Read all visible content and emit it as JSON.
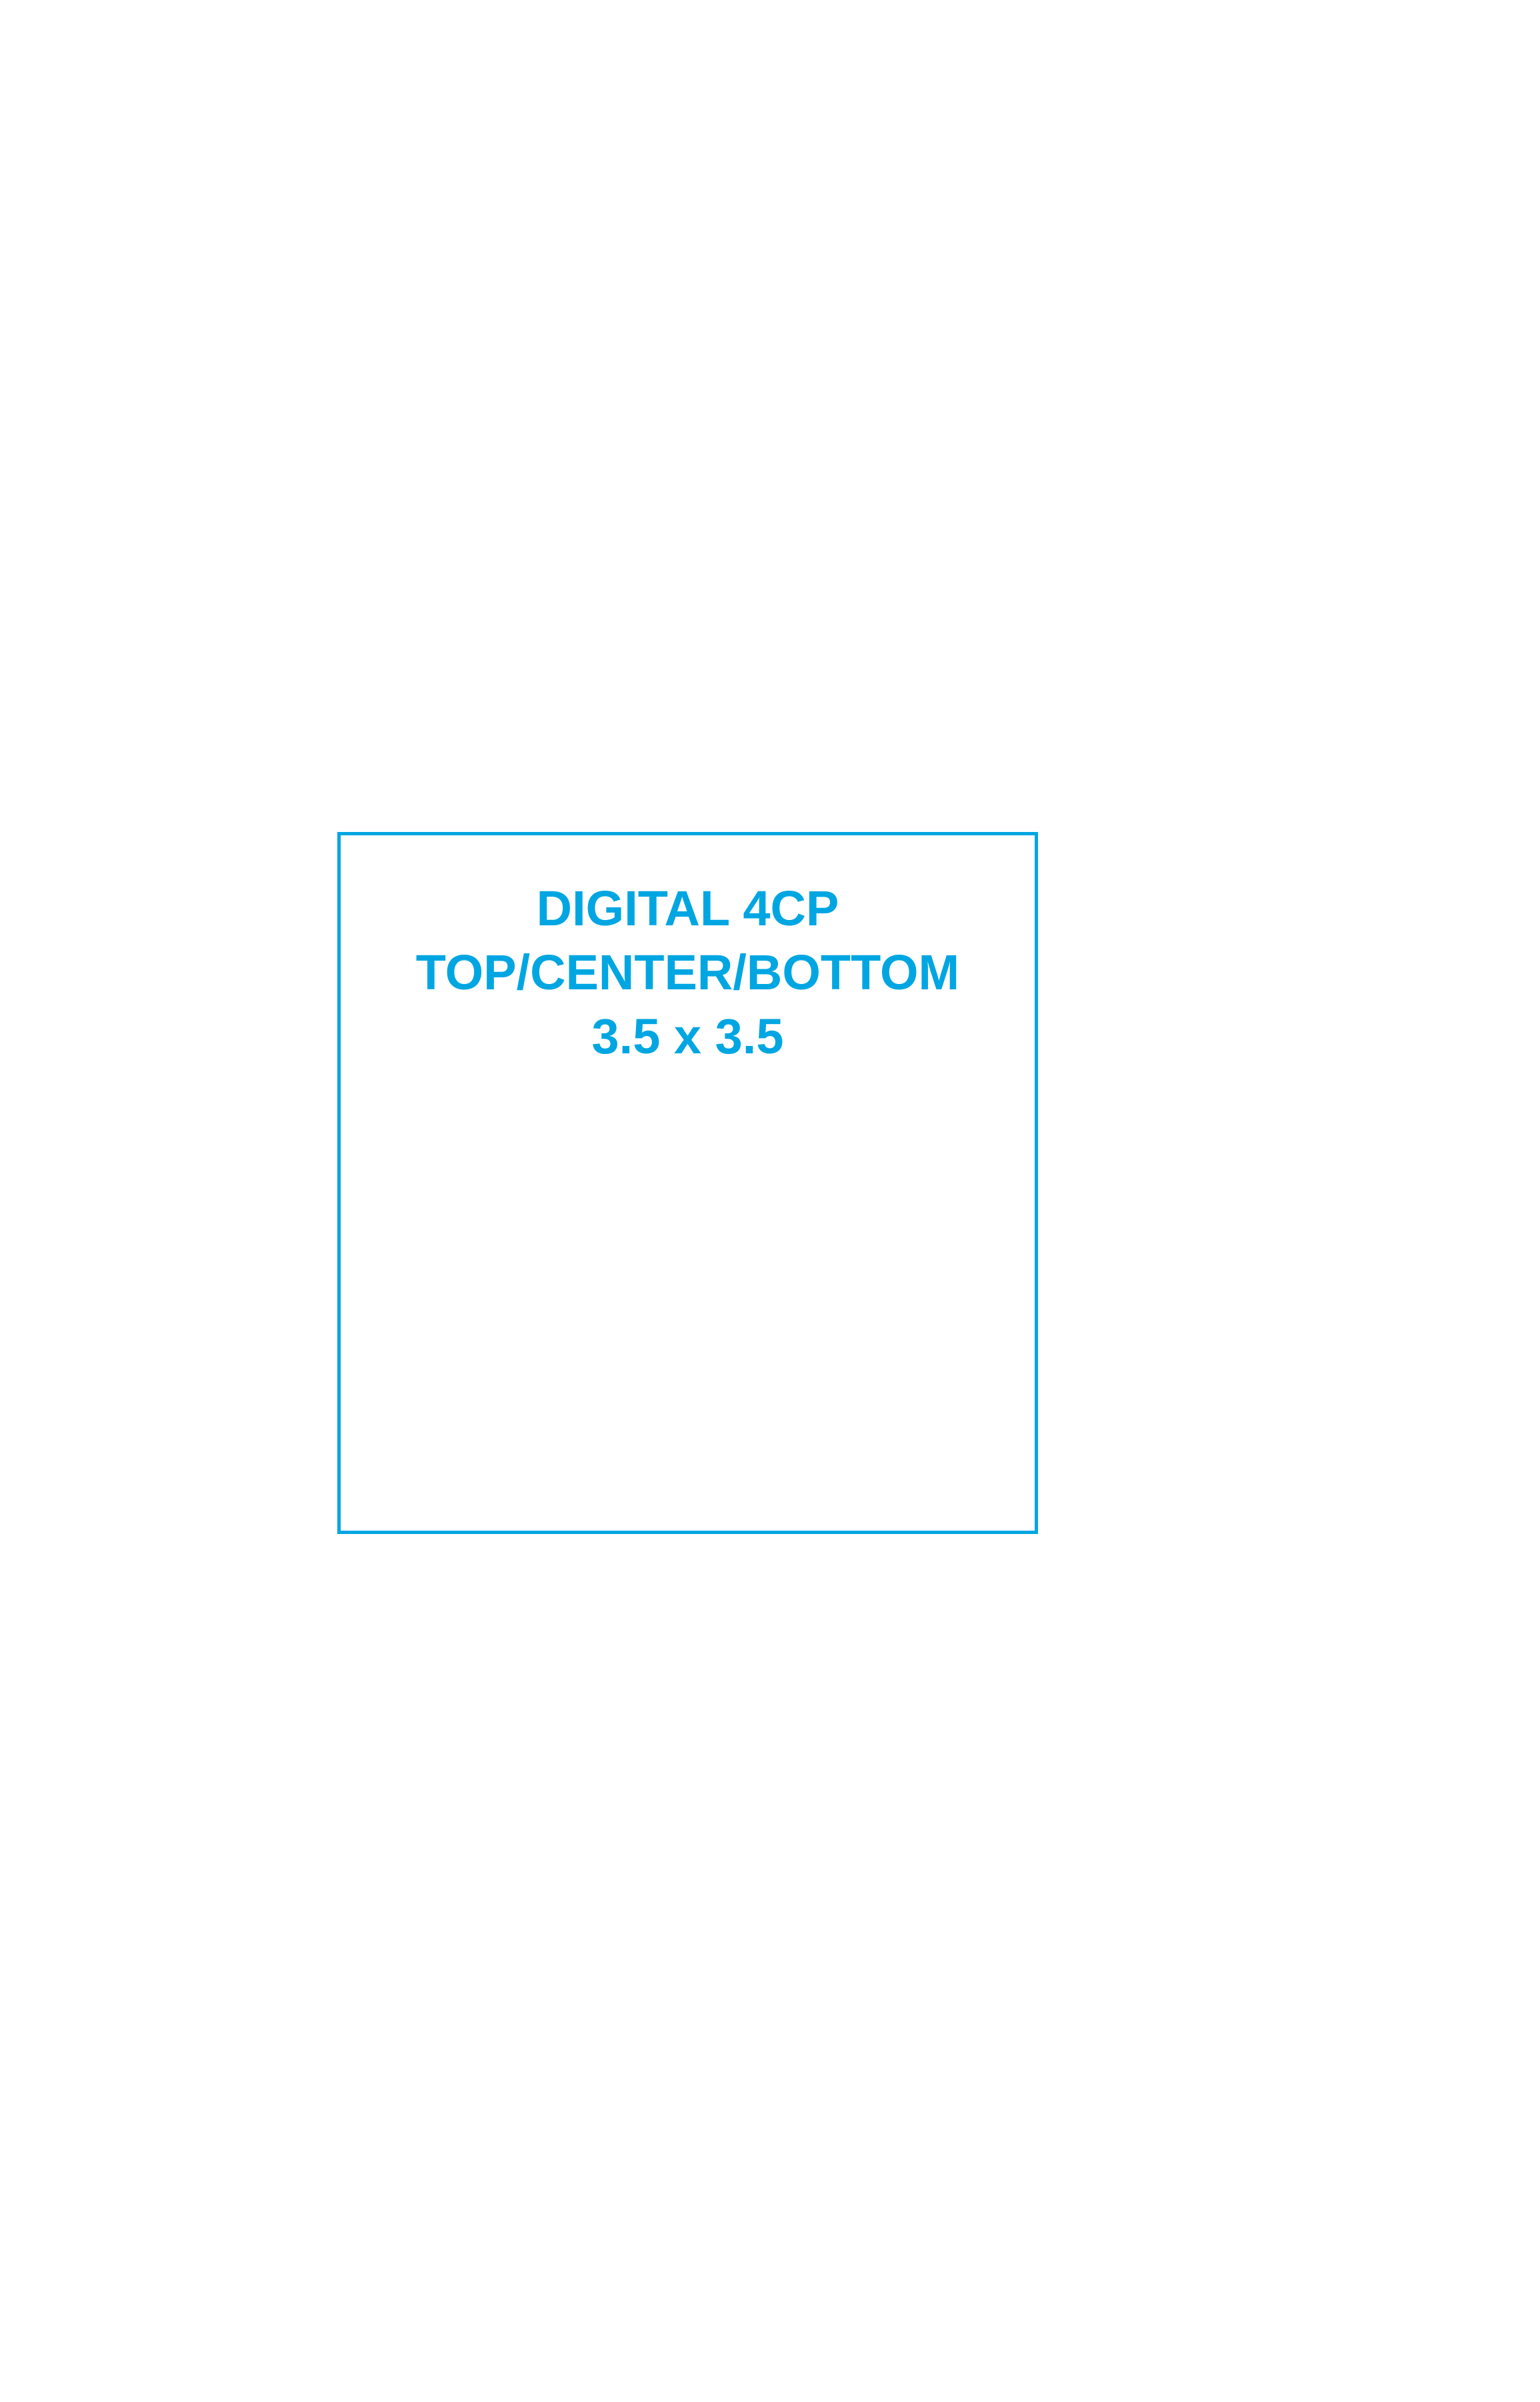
{
  "template": {
    "lines": [
      "DIGITAL 4CP",
      "TOP/CENTER/BOTTOM",
      "3.5 x 3.5"
    ],
    "accent_color": "#00A6E2"
  }
}
